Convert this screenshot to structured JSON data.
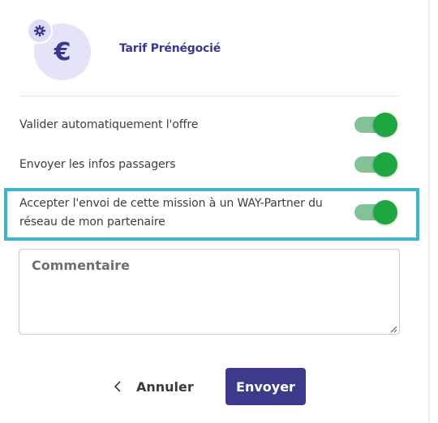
{
  "header": {
    "icon": "euro-icon",
    "badge_icon": "gear-icon",
    "title": "Tarif Prénégocié",
    "euro_symbol": "€"
  },
  "options": [
    {
      "label": "Valider automatiquement l'offre",
      "enabled": true
    },
    {
      "label": "Envoyer les infos passagers",
      "enabled": true
    },
    {
      "label_line1": "Accepter l'envoi de cette mission à un WAY-Partner du",
      "label_line2": "réseau de mon partenaire",
      "enabled": true,
      "highlighted": true
    }
  ],
  "comment": {
    "placeholder": "Commentaire",
    "value": ""
  },
  "footer": {
    "cancel_label": "Annuler",
    "cancel_icon": "chevron-left-icon",
    "send_label": "Envoyer"
  },
  "colors": {
    "brand": "#3d3a8c",
    "toggle_on": "#1ea640",
    "toggle_track": "#84c197",
    "highlight": "#3cb4d3"
  }
}
